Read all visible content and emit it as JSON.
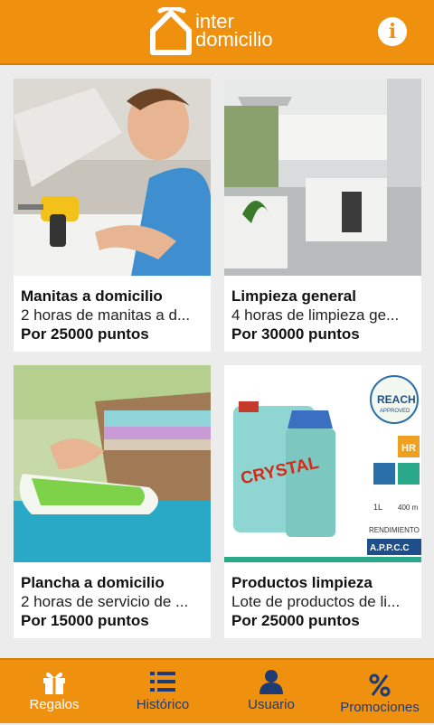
{
  "header": {
    "logo_line1": "inter",
    "logo_line2": "domicilio",
    "info_label": "i"
  },
  "cards": [
    {
      "title": "Manitas a domicilio",
      "desc": "2 horas de manitas a d...",
      "price": "Por 25000 puntos"
    },
    {
      "title": "Limpieza general",
      "desc": "4 horas de limpieza ge...",
      "price": "Por 30000 puntos"
    },
    {
      "title": "Plancha a domicilio",
      "desc": "2 horas de servicio de ...",
      "price": "Por 15000 puntos"
    },
    {
      "title": "Productos limpieza",
      "desc": "Lote de productos de li...",
      "price": "Por 25000 puntos"
    }
  ],
  "product_image": {
    "brand": "CRYSTAL",
    "badge": "REACH",
    "badge_sub": "APPROVED",
    "hr": "HR",
    "volume": "1L",
    "ml": "400 m",
    "rendimiento": "RENDIMIENTO",
    "appcc": "A.P.P.C.C"
  },
  "tabs": [
    {
      "label": "Regalos",
      "icon": "gift-icon"
    },
    {
      "label": "Histórico",
      "icon": "list-icon"
    },
    {
      "label": "Usuario",
      "icon": "user-icon"
    },
    {
      "label": "Promociones",
      "icon": "percent-icon"
    }
  ],
  "colors": {
    "accent": "#f0900f",
    "tab_inactive": "#1e3b73"
  }
}
